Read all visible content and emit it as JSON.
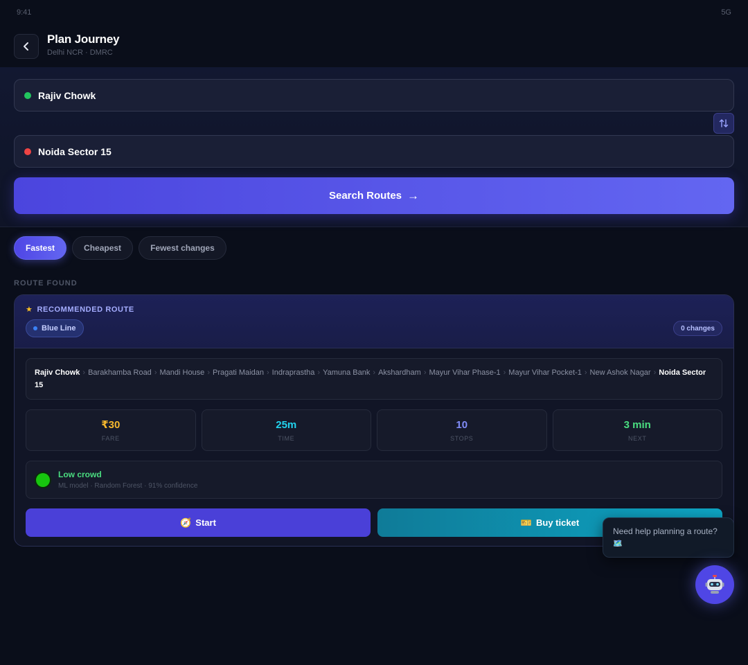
{
  "status": {
    "time": "9:41",
    "network": "5G"
  },
  "header": {
    "title": "Plan Journey",
    "subtitle": "Delhi NCR · DMRC"
  },
  "search": {
    "from": "Rajiv Chowk",
    "to": "Noida Sector 15",
    "button_label": "Search Routes",
    "button_arrow": "→"
  },
  "filters": [
    "Fastest",
    "Cheapest",
    "Fewest changes"
  ],
  "active_filter": "Fastest",
  "section_label": "ROUTE FOUND",
  "route": {
    "tag": "RECOMMENDED ROUTE",
    "line": "Blue Line",
    "line_color": "#3b82f6",
    "changes": "0 changes",
    "stops": [
      "Rajiv Chowk",
      "Barakhamba Road",
      "Mandi House",
      "Pragati Maidan",
      "Indraprastha",
      "Yamuna Bank",
      "Akshardham",
      "Mayur Vihar Phase-1",
      "Mayur Vihar Pocket-1",
      "New Ashok Nagar",
      "Noida Sector 15"
    ],
    "stats": [
      {
        "value": "₹30",
        "label": "FARE",
        "color": "#f5b82e"
      },
      {
        "value": "25m",
        "label": "TIME",
        "color": "#22d3ee"
      },
      {
        "value": "10",
        "label": "STOPS",
        "color": "#818cf8"
      },
      {
        "value": "3 min",
        "label": "NEXT",
        "color": "#4ade80"
      }
    ],
    "crowd": {
      "title": "Low crowd",
      "subtitle": "ML model · Random Forest · 91% confidence"
    },
    "actions": {
      "start": "Start",
      "start_icon": "🧭",
      "buy": "Buy ticket",
      "buy_icon": "🎫"
    }
  },
  "help": {
    "text": "Need help planning a route?",
    "icon": "🗺️"
  }
}
